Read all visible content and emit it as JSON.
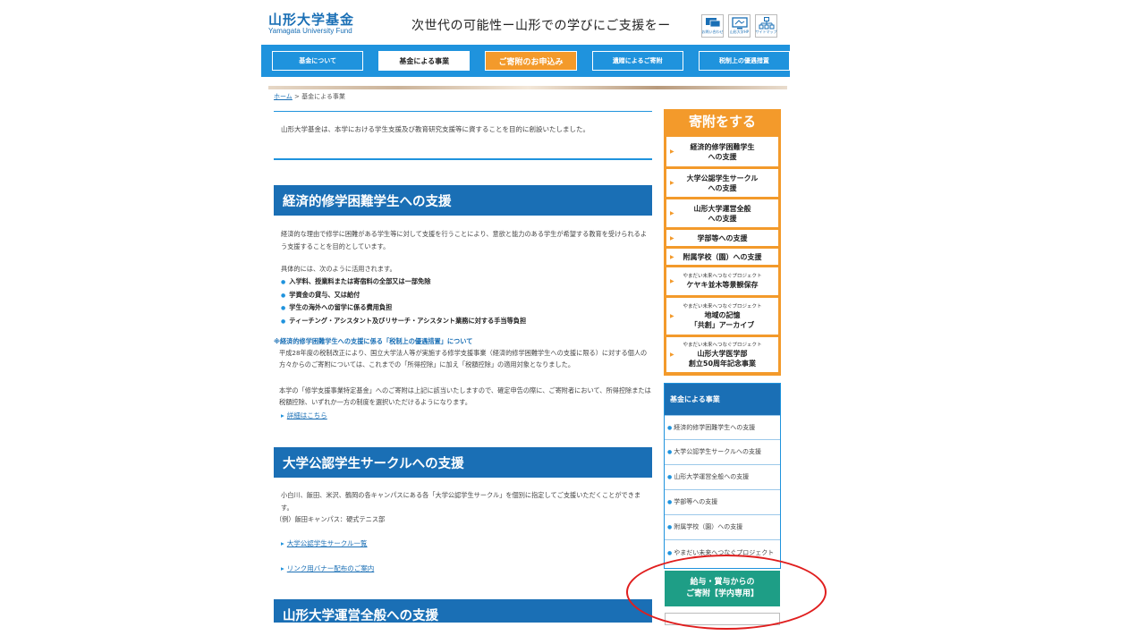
{
  "header": {
    "logo_main": "山形大学基金",
    "logo_sub": "Yamagata University Fund",
    "tagline": "次世代の可能性ー山形での学びにご支援をー",
    "icons": [
      {
        "name": "chat-icon",
        "label": "お問い合わせ"
      },
      {
        "name": "monitor-icon",
        "label": "山形大学HP"
      },
      {
        "name": "sitemap-icon",
        "label": "サイトマップ"
      }
    ]
  },
  "nav": {
    "items": [
      "基金について",
      "基金による事業",
      "ご寄附のお申込み",
      "遺贈によるご寄附",
      "税制上の優遇措置"
    ]
  },
  "breadcrumb": {
    "home": "ホーム",
    "sep": " > ",
    "current": "基金による事業"
  },
  "intro": "山形大学基金は、本学における学生支援及び教育研究支援等に資することを目的に創設いたしました。",
  "section1": {
    "title": "経済的修学困難学生への支援",
    "p1": "経済的な理由で修学に困難がある学生等に対して支援を行うことにより、意欲と能力のある学生が希望する教育を受けられるよう支援することを目的としています。",
    "p2": "具体的には、次のように活用されます。",
    "bullets": [
      "入学料、授業料または寄宿料の全部又は一部免除",
      "学資金の貸与、又は給付",
      "学生の海外への留学に係る費用負担",
      "ティーチング・アシスタント及びリサーチ・アシスタント業務に対する手当等負担"
    ],
    "note_title": "※経済的修学困難学生への支援に係る「税制上の優遇措置」について",
    "note_body": "平成28年度の税制改正により、国立大学法人等が実施する修学支援事業（経済的修学困難学生への支援に限る）に対する個人の方々からのご寄附については、これまでの「所得控除」に加え「税額控除」の適用対象となりました。",
    "note_body2": "本学の「修学支援事業特定基金」へのご寄附は上記に該当いたしますので、確定申告の際に、ご寄附者において、所得控除または税額控除、いずれか一方の制度を選択いただけるようになります。",
    "link": "詳細はこちら"
  },
  "section2": {
    "title": "大学公認学生サークルへの支援",
    "p1": "小白川、飯田、米沢、鶴岡の各キャンパスにある各「大学公認学生サークル」を個別に指定してご支援いただくことができます。",
    "p2": "（例）飯田キャンパス：硬式テニス部",
    "links": [
      "大学公認学生サークル一覧",
      "リンク用バナー配布のご案内"
    ]
  },
  "section3": {
    "title": "山形大学運営全般への支援"
  },
  "sidebar": {
    "donate_title": "寄附をする",
    "donate_items": [
      {
        "proj": "",
        "label": "経済的修学困難学生\nへの支援"
      },
      {
        "proj": "",
        "label": "大学公認学生サークル\nへの支援"
      },
      {
        "proj": "",
        "label": "山形大学運営全般\nへの支援"
      },
      {
        "proj": "",
        "label": "学部等への支援"
      },
      {
        "proj": "",
        "label": "附属学校（園）への支援"
      },
      {
        "proj": "やまだい未来へつなぐプロジェクト",
        "label": "ケヤキ並木等景観保存"
      },
      {
        "proj": "やまだい未来へつなぐプロジェクト",
        "label": "地域の記憶\n「共創」アーカイブ"
      },
      {
        "proj": "やまだい未来へつなぐプロジェクト",
        "label": "山形大学医学部\n創立50周年記念事業"
      }
    ],
    "fund_title": "基金による事業",
    "fund_items": [
      "経済的修学困難学生への支援",
      "大学公認学生サークルへの支援",
      "山形大学運営全般への支援",
      "学部等への支援",
      "附属学校（園）への支援",
      "やまだい未来へつなぐプロジェクト"
    ],
    "salary_line1": "給与・賞与からの",
    "salary_line2": "ご寄附【学内専用】"
  },
  "colors": {
    "nav_blue": "#1f93dd",
    "section_blue": "#1a6fb5",
    "orange": "#f39a2b",
    "teal": "#1e9e86",
    "annotation_red": "#e01e1e"
  }
}
